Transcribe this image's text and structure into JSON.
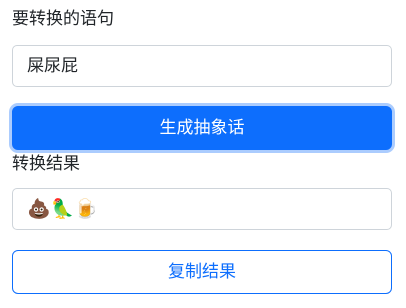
{
  "input_section": {
    "label": "要转换的语句",
    "value": "屎尿屁"
  },
  "generate_button": {
    "label": "生成抽象话"
  },
  "output_section": {
    "label": "转换结果",
    "value": "💩🦜🍺"
  },
  "copy_button": {
    "label": "复制结果"
  },
  "colors": {
    "primary": "#0d6efd",
    "border": "#ced4da",
    "text": "#212529"
  }
}
